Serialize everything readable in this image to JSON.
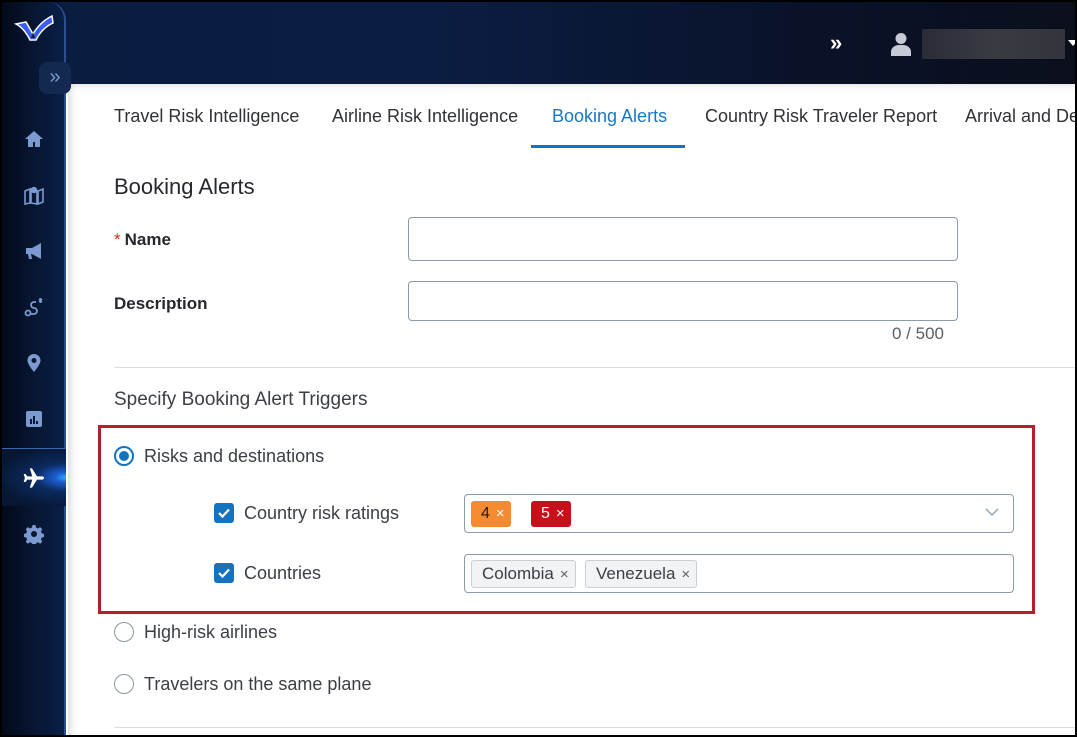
{
  "topbar": {
    "expand_icon": "double-chevron-right",
    "user_icon": "user-icon",
    "user_name": ""
  },
  "sidebar": {
    "expand_glyph": "»",
    "items": [
      {
        "name": "home",
        "icon": "home-icon",
        "active": false
      },
      {
        "name": "map",
        "icon": "map-pin-icon",
        "active": false
      },
      {
        "name": "alerts",
        "icon": "megaphone-icon",
        "active": false
      },
      {
        "name": "routes",
        "icon": "route-icon",
        "active": false
      },
      {
        "name": "locations",
        "icon": "location-pin-icon",
        "active": false
      },
      {
        "name": "reports",
        "icon": "bar-chart-icon",
        "active": false
      },
      {
        "name": "travel",
        "icon": "airplane-icon",
        "active": true
      },
      {
        "name": "settings",
        "icon": "gear-icon",
        "active": false
      }
    ]
  },
  "tabs": [
    {
      "label": "Travel Risk Intelligence",
      "active": false
    },
    {
      "label": "Airline Risk Intelligence",
      "active": false
    },
    {
      "label": "Booking Alerts",
      "active": true
    },
    {
      "label": "Country Risk Traveler Report",
      "active": false
    },
    {
      "label": "Arrival and Dep",
      "active": false
    }
  ],
  "form": {
    "title": "Booking Alerts",
    "name_label": "Name",
    "required_mark": "*",
    "name_value": "",
    "description_label": "Description",
    "description_value": "",
    "char_counter": "0 / 500"
  },
  "triggers": {
    "title": "Specify Booking Alert Triggers",
    "options": [
      {
        "label": "Risks and destinations",
        "selected": true
      },
      {
        "label": "High-risk airlines",
        "selected": false
      },
      {
        "label": "Travelers on the same plane",
        "selected": false
      }
    ],
    "risk_ratings": {
      "label": "Country risk ratings",
      "checked": true,
      "chips": [
        {
          "value": "4",
          "color": "#f58a31"
        },
        {
          "value": "5",
          "color": "#c8101b"
        }
      ]
    },
    "countries": {
      "label": "Countries",
      "checked": true,
      "chips": [
        "Colombia",
        "Venezuela"
      ]
    },
    "remove_glyph": "×"
  }
}
